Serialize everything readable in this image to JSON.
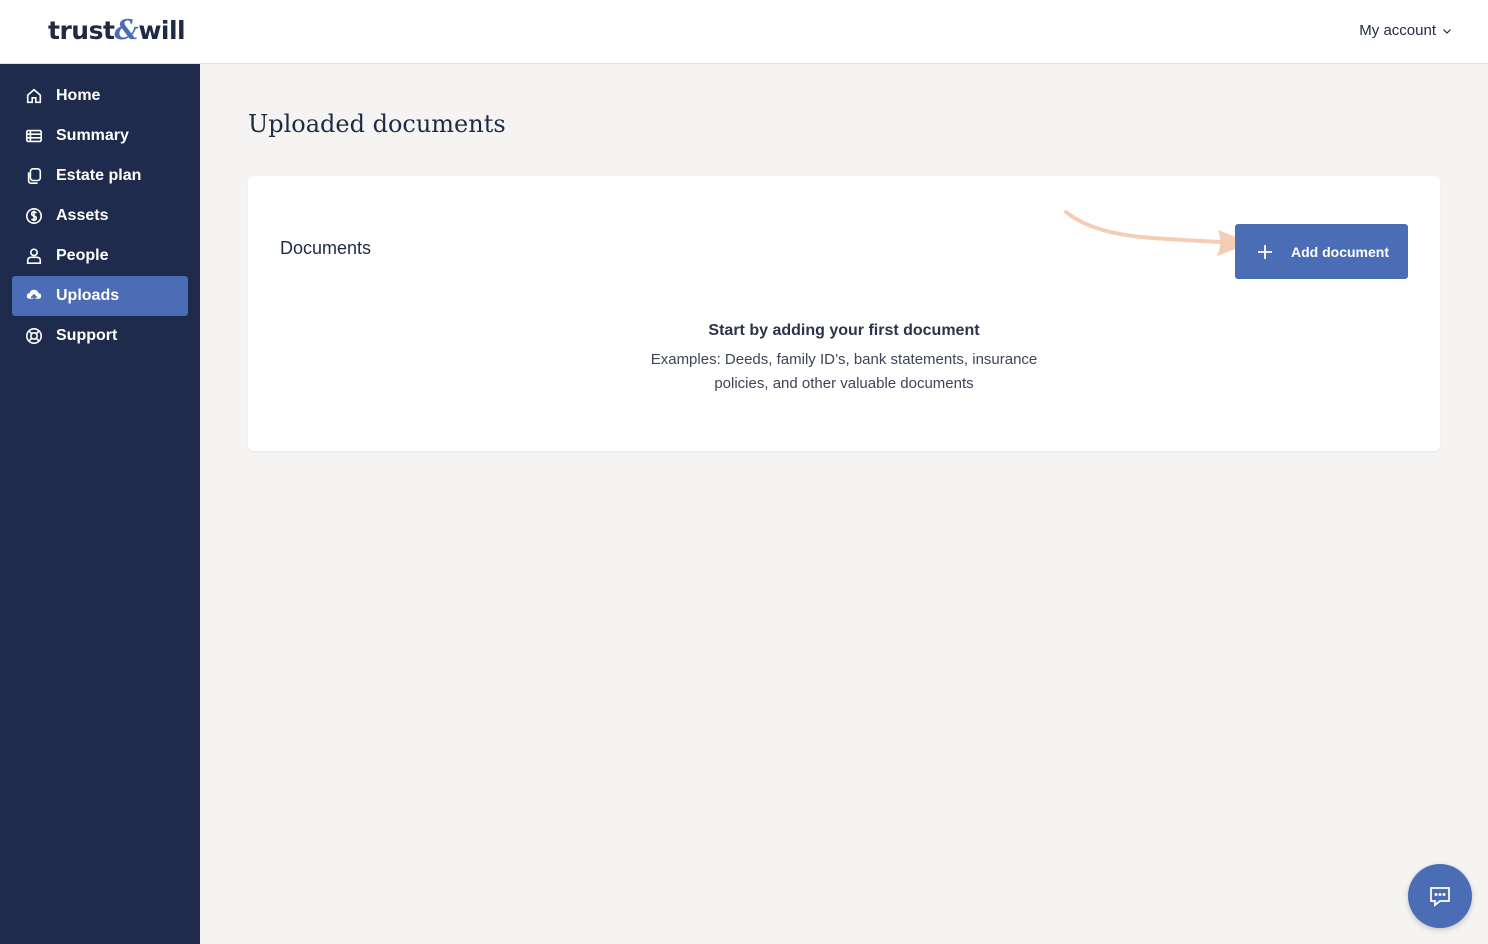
{
  "header": {
    "logo_left": "trust",
    "logo_amp": "&",
    "logo_right": "will",
    "account_label": "My account"
  },
  "sidebar": {
    "items": [
      {
        "label": "Home",
        "icon": "home-icon"
      },
      {
        "label": "Summary",
        "icon": "summary-icon"
      },
      {
        "label": "Estate plan",
        "icon": "estate-plan-icon"
      },
      {
        "label": "Assets",
        "icon": "dollar-icon"
      },
      {
        "label": "People",
        "icon": "people-icon"
      },
      {
        "label": "Uploads",
        "icon": "upload-cloud-icon",
        "active": true
      },
      {
        "label": "Support",
        "icon": "lifebuoy-icon"
      }
    ]
  },
  "main": {
    "title": "Uploaded documents",
    "card": {
      "title": "Documents",
      "add_button": "Add document",
      "empty_title": "Start by adding your first document",
      "empty_description": "Examples: Deeds, family ID’s, bank statements, insurance policies, and other valuable documents"
    }
  },
  "colors": {
    "sidebar_bg": "#1f2b4d",
    "accent": "#4a6db5",
    "arrow": "#f4cdb5",
    "page_bg": "#f5f4f2"
  }
}
